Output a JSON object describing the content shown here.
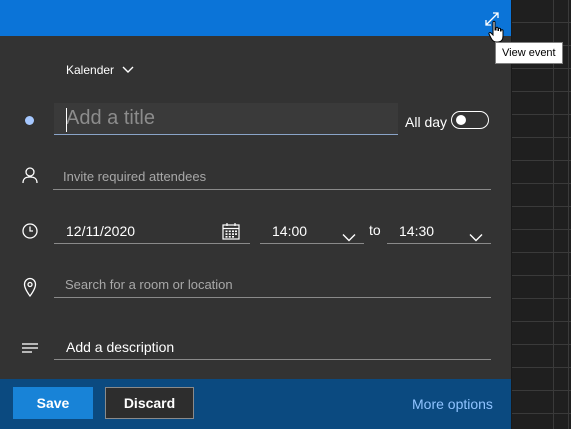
{
  "header": {
    "expand_icon": "expand-diagonal-icon",
    "tooltip": "View event"
  },
  "calendar_select": {
    "label": "Kalender",
    "icon": "chevron-down-icon"
  },
  "title": {
    "placeholder": "Add a title",
    "status_dot_color": "#a6c8ff"
  },
  "all_day": {
    "label": "All day",
    "checked": false
  },
  "attendees": {
    "icon": "person-icon",
    "placeholder": "Invite required attendees"
  },
  "datetime": {
    "icon": "clock-icon",
    "date": "12/11/2020",
    "date_icon": "calendar-icon",
    "start_time": "14:00",
    "to_label": "to",
    "end_time": "14:30"
  },
  "location": {
    "icon": "location-pin-icon",
    "placeholder": "Search for a room or location"
  },
  "description": {
    "icon": "text-lines-icon",
    "label": "Add a description"
  },
  "footer": {
    "save_label": "Save",
    "discard_label": "Discard",
    "more_options_label": "More options"
  },
  "colors": {
    "accent": "#0b74d8",
    "footer": "#0b4a80",
    "save_button": "#1883d7",
    "link": "#8fc3ff",
    "panel": "#333333"
  }
}
